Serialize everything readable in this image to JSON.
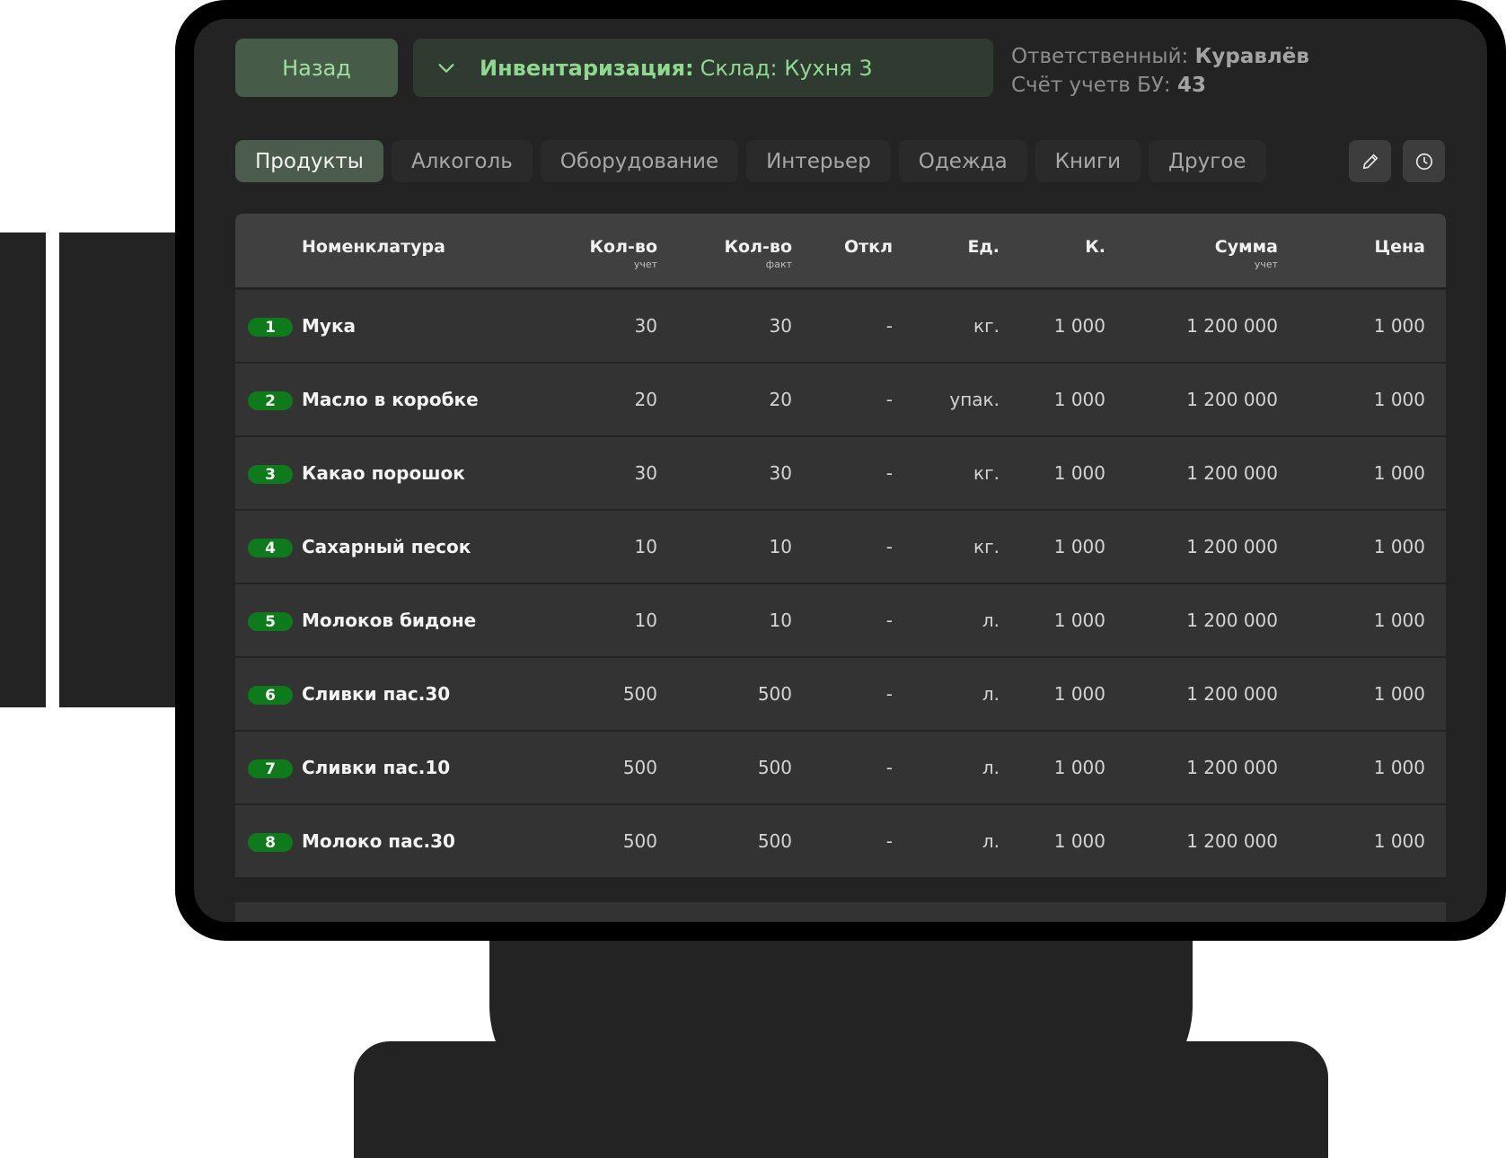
{
  "header": {
    "back_label": "Назад",
    "title_prefix": "Инвентаризация:",
    "title_value": "Склад: Кухня 3",
    "responsible_label": "Ответственный:",
    "responsible_value": "Куравлёв",
    "account_label": "Счёт учетв БУ:",
    "account_value": "43"
  },
  "tabs": [
    {
      "label": "Продукты",
      "active": true
    },
    {
      "label": "Алкоголь",
      "active": false
    },
    {
      "label": "Оборудование",
      "active": false
    },
    {
      "label": "Интерьер",
      "active": false
    },
    {
      "label": "Одежда",
      "active": false
    },
    {
      "label": "Книги",
      "active": false
    },
    {
      "label": "Другое",
      "active": false
    }
  ],
  "toolbar": {
    "edit_icon": "pencil-icon",
    "history_icon": "clock-icon"
  },
  "table": {
    "columns": {
      "name": "Номенклатура",
      "qty_acc": "Кол-во",
      "qty_acc_sub": "учет",
      "qty_fact": "Кол-во",
      "qty_fact_sub": "факт",
      "dev": "Откл",
      "unit": "Ед.",
      "k": "К.",
      "sum": "Сумма",
      "sum_sub": "учет",
      "price": "Цена"
    },
    "rows": [
      {
        "n": "1",
        "name": "Мука",
        "qty_acc": "30",
        "qty_fact": "30",
        "dev": "-",
        "unit": "кг.",
        "k": "1 000",
        "sum": "1 200 000",
        "price": "1 000"
      },
      {
        "n": "2",
        "name": "Масло в коробке",
        "qty_acc": "20",
        "qty_fact": "20",
        "dev": "-",
        "unit": "упак.",
        "k": "1 000",
        "sum": "1 200 000",
        "price": "1 000"
      },
      {
        "n": "3",
        "name": "Какао порошок",
        "qty_acc": "30",
        "qty_fact": "30",
        "dev": "-",
        "unit": "кг.",
        "k": "1 000",
        "sum": "1 200 000",
        "price": "1 000"
      },
      {
        "n": "4",
        "name": "Сахарный песок",
        "qty_acc": "10",
        "qty_fact": "10",
        "dev": "-",
        "unit": "кг.",
        "k": "1 000",
        "sum": "1 200 000",
        "price": "1 000"
      },
      {
        "n": "5",
        "name": "Молоков бидоне",
        "qty_acc": "10",
        "qty_fact": "10",
        "dev": "-",
        "unit": "л.",
        "k": "1 000",
        "sum": "1 200 000",
        "price": "1 000"
      },
      {
        "n": "6",
        "name": "Сливки пас.30",
        "qty_acc": "500",
        "qty_fact": "500",
        "dev": "-",
        "unit": "л.",
        "k": "1 000",
        "sum": "1 200 000",
        "price": "1 000"
      },
      {
        "n": "7",
        "name": "Сливки пас.10",
        "qty_acc": "500",
        "qty_fact": "500",
        "dev": "-",
        "unit": "л.",
        "k": "1 000",
        "sum": "1 200 000",
        "price": "1 000"
      },
      {
        "n": "8",
        "name": "Молоко пас.30",
        "qty_acc": "500",
        "qty_fact": "500",
        "dev": "-",
        "unit": "л.",
        "k": "1 000",
        "sum": "1 200 000",
        "price": "1 000"
      }
    ]
  },
  "colors": {
    "accent_green": "#90d890",
    "index_badge": "#0e7a1c",
    "screen_bg": "#232323"
  }
}
